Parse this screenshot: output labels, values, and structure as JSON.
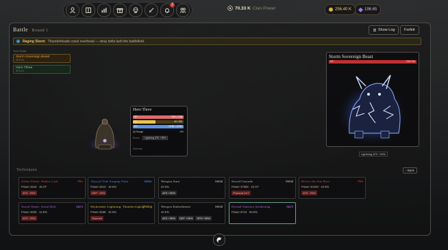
{
  "topbar": {
    "nav_icons": [
      "user-icon",
      "book-icon",
      "chart-icon",
      "gift-icon",
      "skull-icon",
      "sword-icon",
      "bell-icon",
      "group-icon"
    ],
    "bell_badge": "3",
    "power_value": "70.33 K",
    "power_label": "Clan Power",
    "gold": "256.40 K",
    "gems": "196.65"
  },
  "battle": {
    "title": "Battle",
    "round": "Round 1",
    "show_log": "Show Log",
    "forfeit": "Forfeit"
  },
  "banner": {
    "heading": "Raging Storm",
    "text": "Thunderheads crack overhead — stray bolts lash the battlefield."
  },
  "turn_order": {
    "label": "Turn Order",
    "items": [
      {
        "name": "Storm Sovereign Beast",
        "sub": "SPD 54"
      },
      {
        "name": "Hero Three",
        "sub": "SPD 51"
      }
    ]
  },
  "enemy": {
    "name": "Storm Sovereign Beast",
    "hp_label": "HP",
    "hp_value": "70K/70K",
    "hp_fraction": 1.0,
    "aura": "Lightning ATK +28%"
  },
  "hero": {
    "name": "Hero Three",
    "hp_label": "HP",
    "hp_value": "7.5K / 7.5K",
    "hp_fraction": 1.0,
    "qi_label": "QI",
    "qi_value": "44 / 100",
    "qi_fraction": 0.44,
    "en_label": "EN",
    "en_value": "10.8K / 10.8K",
    "en_fraction": 1.0,
    "surge_label": "Qi Surge",
    "surge_value": "0%",
    "boons_label": "Boons",
    "boon": "Lightning ATK +28%",
    "ailments_label": "Ailments"
  },
  "techniques": {
    "label": "Techniques",
    "back": "Back",
    "cards": [
      {
        "name": "Ashen Flame: Ember Lash",
        "element": "Fire",
        "stats": "Power 2616 · 16 ST",
        "tags": [
          "ATK −25%"
        ],
        "color": "#e04a3a"
      },
      {
        "name": "Abyssal Tide Surging Palm",
        "element": "Water",
        "stats": "Power 3613 · 16 EN",
        "tags": [
          "DEF −20%"
        ],
        "color": "#4a8ce0"
      },
      {
        "name": "Weapon Aura",
        "element": "Metal",
        "stats": "20 EN",
        "tags": [
          "ATK +30%"
        ],
        "color": "#c8c2b2"
      },
      {
        "name": "Sword Cascade",
        "element": "Metal",
        "stats": "Power 37506 · 34 ST",
        "tags": [
          "Physical DoT"
        ],
        "color": "#c8c2b2"
      },
      {
        "name": "Before the Sun Rose",
        "element": "Fire",
        "stats": "Power 40429 · 44 EN",
        "tags": [
          "ATK −25%"
        ],
        "color": "#e04a3a"
      },
      {
        "name": "Astral Omen: Astral Bolt",
        "element": "Spirit",
        "stats": "Power 3625 · 12 EN",
        "tags": [
          "ATK −25%"
        ],
        "color": "#b36ee0"
      },
      {
        "name": "Skybreaker Lightning: Thunderclap",
        "element": "Lightning",
        "stats": "Power 5568 · 32 EN",
        "tags": [
          "Stunned"
        ],
        "color": "#e0c23a"
      },
      {
        "name": "Weapon Embodiment",
        "element": "Metal",
        "stats": "40 EN",
        "tags": [
          "ATK +35%",
          "DEF +35%",
          "SPD +35%"
        ],
        "color": "#c8c2b2"
      },
      {
        "name": "Eternal Samsara Awakening",
        "element": "Spirit",
        "stats": "Power 6713 · 50 EN",
        "tags": [],
        "color": "#b36ee0"
      }
    ]
  }
}
